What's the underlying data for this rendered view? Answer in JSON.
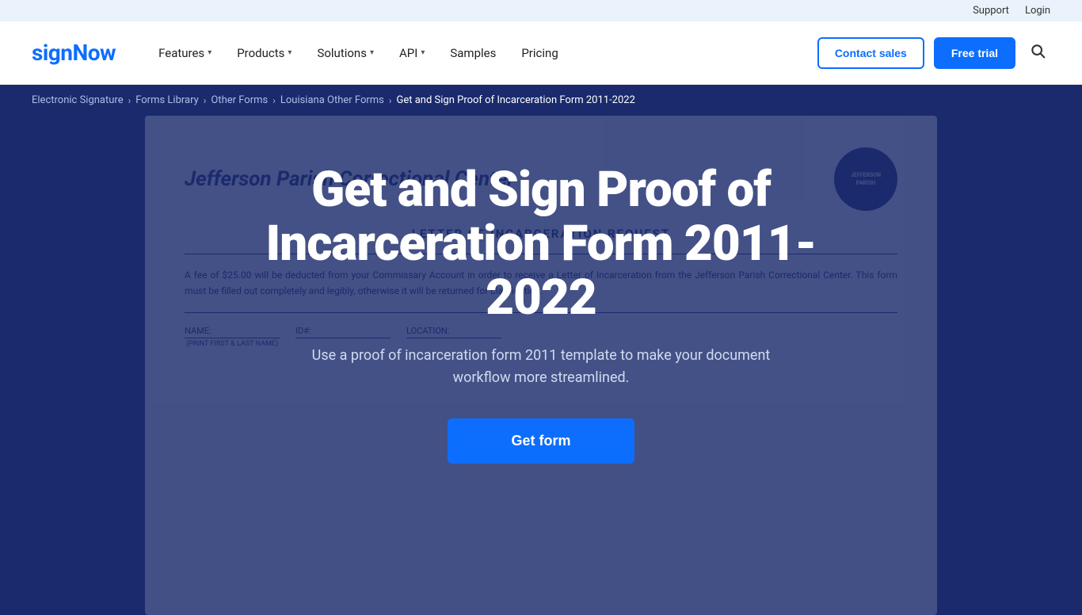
{
  "topbar": {
    "support_label": "Support",
    "login_label": "Login"
  },
  "header": {
    "logo": "signNow",
    "nav": [
      {
        "id": "features",
        "label": "Features",
        "hasDropdown": true
      },
      {
        "id": "products",
        "label": "Products",
        "hasDropdown": true
      },
      {
        "id": "solutions",
        "label": "Solutions",
        "hasDropdown": true
      },
      {
        "id": "api",
        "label": "API",
        "hasDropdown": true
      },
      {
        "id": "samples",
        "label": "Samples",
        "hasDropdown": false
      },
      {
        "id": "pricing",
        "label": "Pricing",
        "hasDropdown": false
      }
    ],
    "contact_sales_label": "Contact sales",
    "free_trial_label": "Free trial"
  },
  "breadcrumb": {
    "items": [
      {
        "id": "electronic-signature",
        "label": "Electronic Signature"
      },
      {
        "id": "forms-library",
        "label": "Forms Library"
      },
      {
        "id": "other-forms",
        "label": "Other Forms"
      },
      {
        "id": "louisiana-other-forms",
        "label": "Louisiana Other Forms"
      }
    ],
    "current": "Get and Sign Proof of Incarceration Form 2011-2022"
  },
  "hero": {
    "title": "Get and Sign Proof of Incarceration Form 2011-2022",
    "subtitle": "Use a proof of incarceration form 2011 template to make your document workflow more streamlined.",
    "get_form_label": "Get form",
    "form_bg": {
      "org_name": "Jefferson Parish Correctional Center",
      "badge_text": "JEFFERSON PARISH",
      "letter_title": "LETTER OF INCARCERATION REQUEST",
      "body_text": "A fee of $25.00 will be deducted from your Commissary Account in order to receive a Letter of Incarceration from the Jefferson Parish Correctional Center. This form must be filled out completely and legibly, otherwise it will be returned for clarification.",
      "fields": [
        {
          "label": "NAME:",
          "sub": "(PRINT FIRST & LAST NAME)"
        },
        {
          "label": "ID#:",
          "sub": ""
        },
        {
          "label": "LOCATION:",
          "sub": ""
        }
      ]
    }
  }
}
